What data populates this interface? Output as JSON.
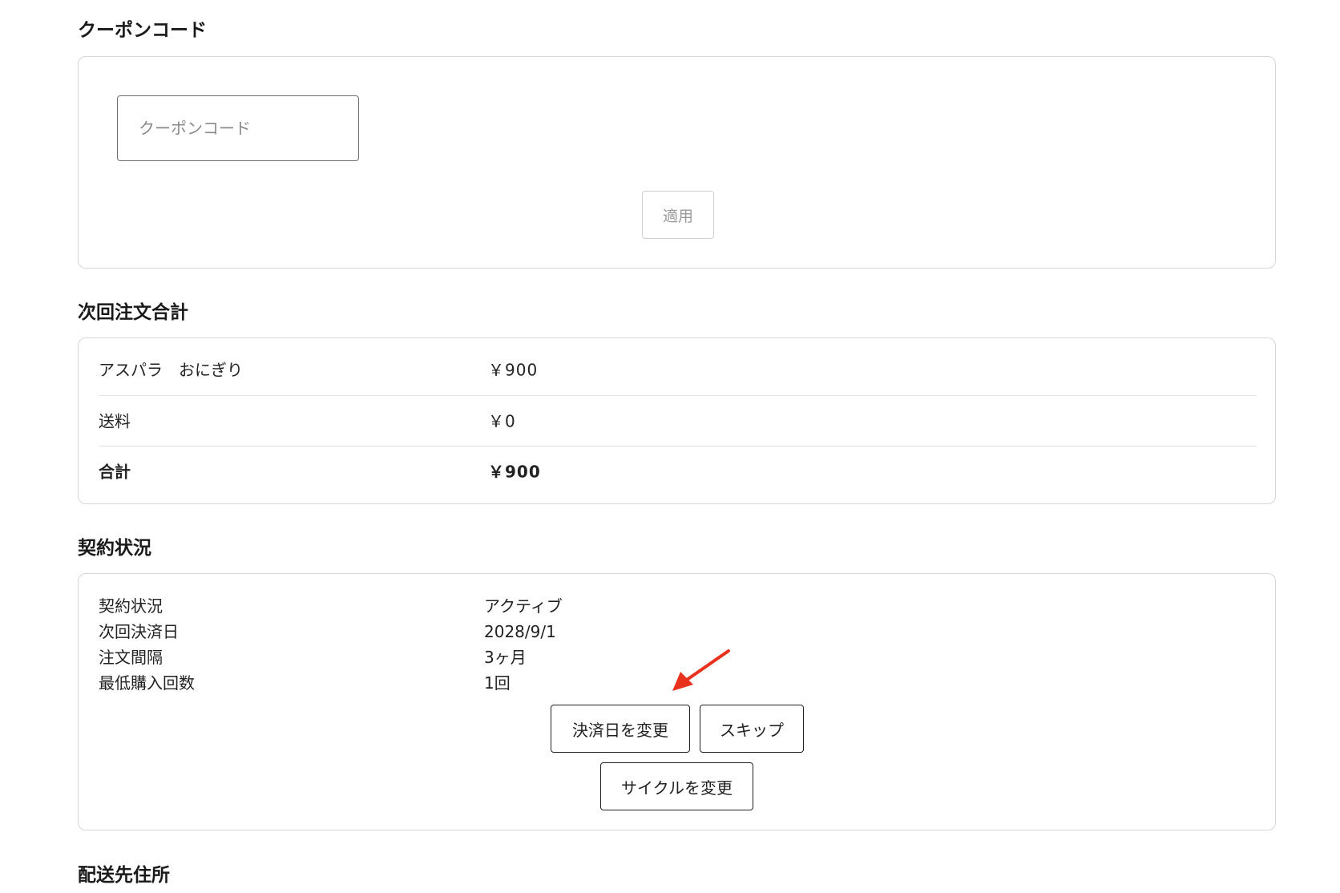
{
  "coupon": {
    "title": "クーポンコード",
    "input_placeholder": "クーポンコード",
    "apply_label": "適用"
  },
  "totals": {
    "title": "次回注文合計",
    "rows": [
      {
        "label": "アスパラ　おにぎり",
        "value": "￥900"
      },
      {
        "label": "送料",
        "value": "￥0"
      },
      {
        "label": "合計",
        "value": "￥900"
      }
    ]
  },
  "contract": {
    "title": "契約状況",
    "rows": [
      {
        "label": "契約状況",
        "value": "アクティブ"
      },
      {
        "label": "次回決済日",
        "value": "2028/9/1"
      },
      {
        "label": "注文間隔",
        "value": "3ヶ月"
      },
      {
        "label": "最低購入回数",
        "value": "1回"
      }
    ],
    "change_date_label": "決済日を変更",
    "skip_label": "スキップ",
    "change_cycle_label": "サイクルを変更"
  },
  "shipping": {
    "title": "配送先住所"
  },
  "colors": {
    "annotation_arrow": "#e8321e"
  }
}
